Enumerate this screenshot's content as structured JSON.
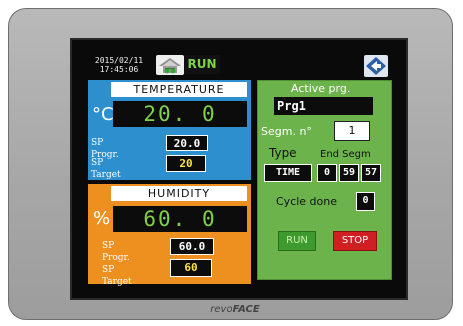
{
  "device": {
    "brand_prefix": "revo",
    "brand_suffix": "FACE"
  },
  "status_bar": {
    "date": "2015/02/11",
    "time": "17:45:06",
    "home_icon": "greenhouse-home-icon",
    "run_status": "RUN",
    "nav_icon": "diamond-arrow-nav-icon"
  },
  "temperature": {
    "title": "TEMPERATURE",
    "unit": "°C",
    "value": "20. 0",
    "sp_progr_label": "SP Progr.",
    "sp_progr_value": "20.0",
    "sp_target_label": "SP Target",
    "sp_target_value": "20"
  },
  "humidity": {
    "title": "HUMIDITY",
    "unit": "%",
    "value": "60. 0",
    "sp_progr_label": "SP Progr.",
    "sp_progr_value": "60.0",
    "sp_target_label": "SP Target",
    "sp_target_value": "60"
  },
  "active_program": {
    "title": "Active prg.",
    "name": "Prg1",
    "segment_label": "Segm. n°",
    "segment_value": "1",
    "type_label": "Type",
    "type_value": "TIME",
    "end_segm_label": "End Segm",
    "end_h": "0",
    "end_m": "59",
    "end_s": "57",
    "cycle_done_label": "Cycle done",
    "cycle_done_value": "0",
    "run_button": "RUN",
    "stop_button": "STOP"
  },
  "colors": {
    "temperature_panel": "#2e8fcf",
    "humidity_panel": "#ee9020",
    "active_panel": "#6cb34c",
    "value_text": "#7fd14a",
    "target_text": "#ffe23d",
    "stop_button": "#cf1f22",
    "run_button": "#3e9a2e"
  }
}
